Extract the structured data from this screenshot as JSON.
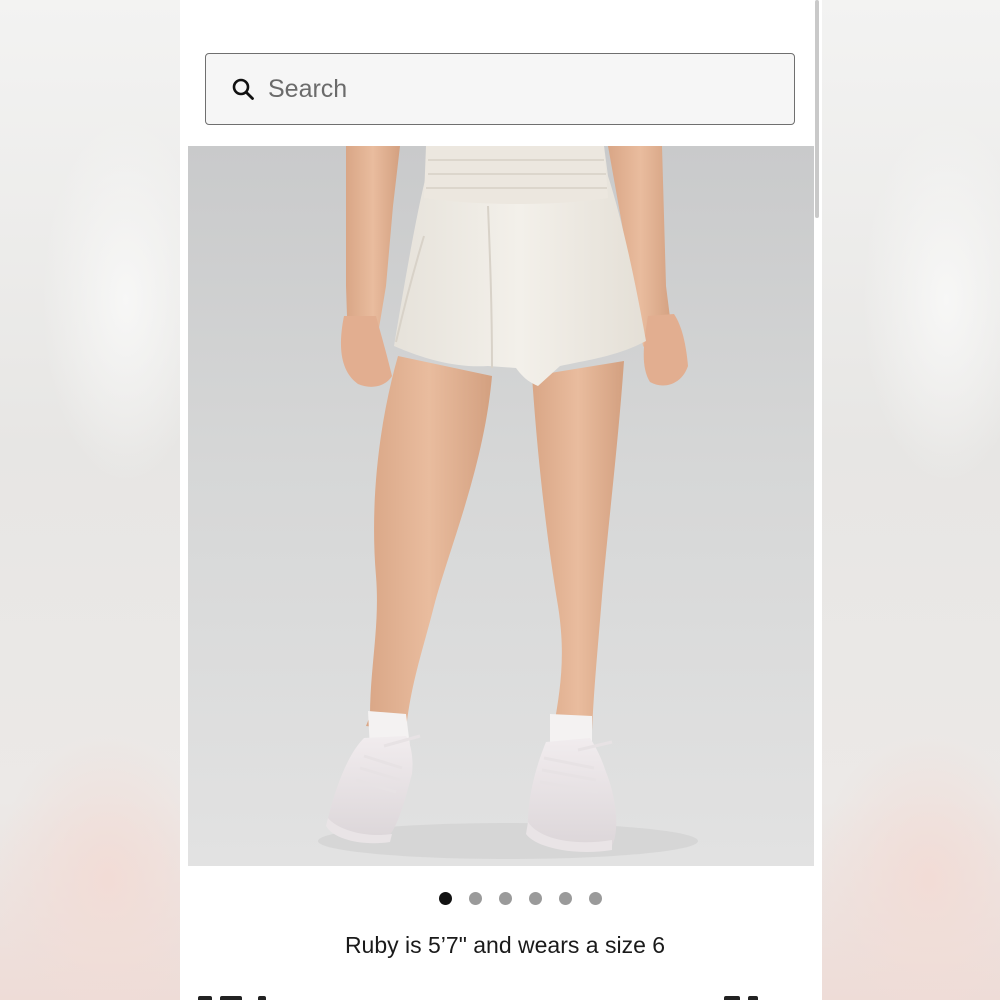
{
  "search": {
    "placeholder": "Search",
    "icon": "search-icon"
  },
  "product_image": {
    "alt": "Model wearing white high-rise running shorts with white socks and white sneakers"
  },
  "carousel": {
    "total_slides": 6,
    "active_index": 0
  },
  "caption": "Ruby is 5’7\" and wears a size 6",
  "colors": {
    "background": "#ffffff",
    "search_bg": "#f6f6f6",
    "search_border": "#6f6f6f",
    "dot_active": "#111111",
    "dot_inactive": "#9a9a9a"
  }
}
